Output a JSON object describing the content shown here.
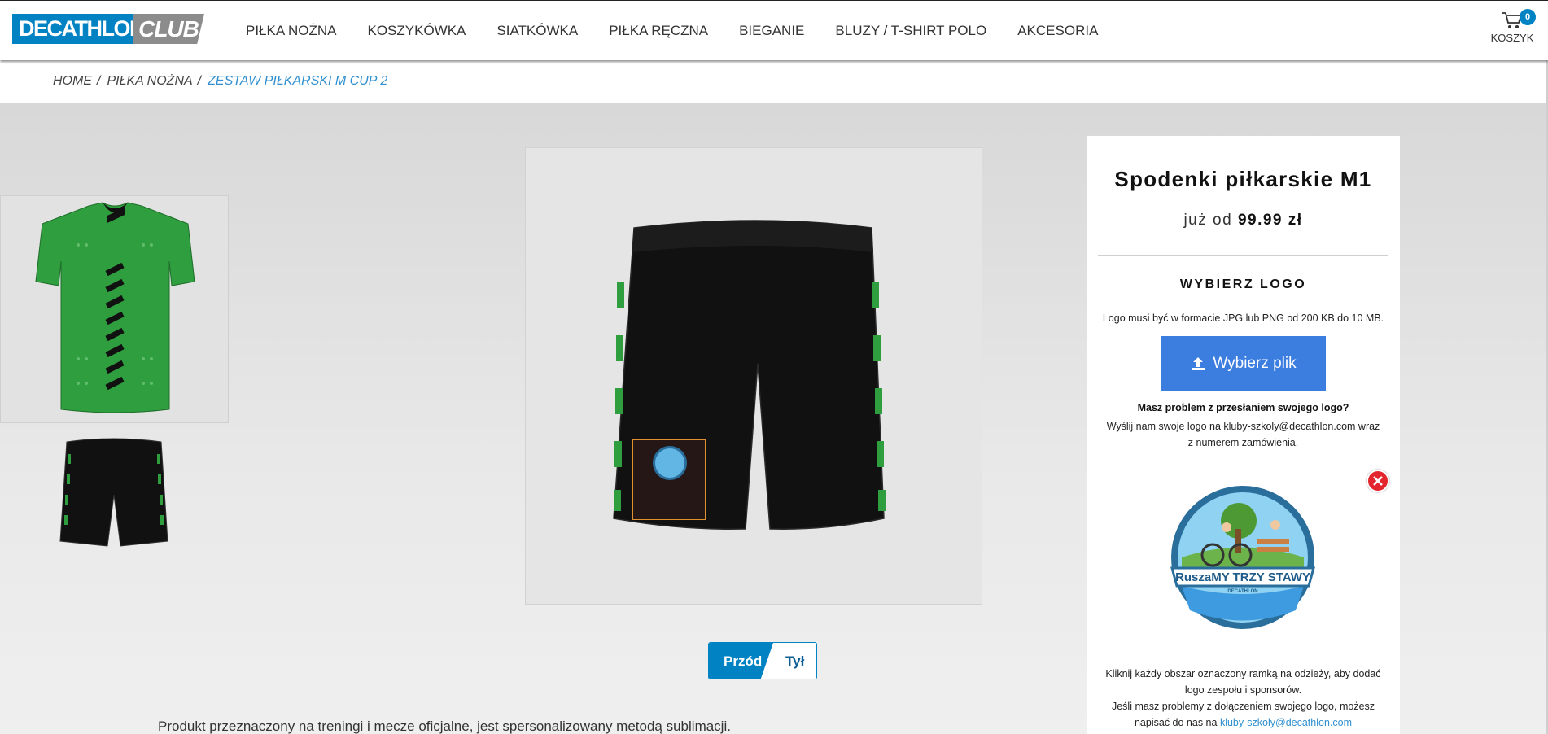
{
  "header": {
    "logo_main": "DECATHLON",
    "logo_sub": "CLUB",
    "nav": [
      {
        "label": "PIŁKA NOŻNA"
      },
      {
        "label": "KOSZYKÓWKA"
      },
      {
        "label": "SIATKÓWKA"
      },
      {
        "label": "PIŁKA RĘCZNA"
      },
      {
        "label": "BIEGANIE"
      },
      {
        "label": "BLUZY / T-SHIRT POLO"
      },
      {
        "label": "AKCESORIA"
      }
    ],
    "cart": {
      "count": "0",
      "label": "KOSZYK",
      "icon": "cart-icon"
    }
  },
  "breadcrumb": [
    {
      "label": "HOME"
    },
    {
      "label": "PIŁKA NOŻNA"
    },
    {
      "label": "ZESTAW PIŁKARSKI M CUP 2"
    }
  ],
  "view_toggle": {
    "front": "Przód",
    "back": "Tył",
    "selected": "Przód"
  },
  "description": "Produkt przeznaczony na treningi i mecze oficjalne, jest spersonalizowany metodą sublimacji.",
  "panel": {
    "product_name": "Spodenki piłkarskie M1",
    "price_prefix": "już od",
    "price": "99.99 zł",
    "choose_logo_title": "WYBIERZ LOGO",
    "logo_format_note": "Logo musi być w formacie JPG lub PNG od 200 KB do 10 MB.",
    "upload_button": "Wybierz plik",
    "problem_question": "Masz problem z przesłaniem swojego logo?",
    "problem_text": "Wyślij nam swoje logo na kluby-szkoly@decathlon.com wraz z numerem zamówienia.",
    "uploaded_logo_text": "RuszaMY TRZY STAWY",
    "uploaded_logo_subtext": "DECATHLON",
    "instructions_1": "Kliknij każdy obszar oznaczony ramką na odzieży, aby dodać logo zespołu i sponsorów.",
    "instructions_2": "Jeśli masz problemy z dołączeniem swojego logo, możesz napisać do nas na",
    "contact_email": "kluby-szkoly@decathlon.com"
  },
  "colors": {
    "brand_blue": "#0082c3",
    "upload_blue": "#3c7de0",
    "jersey_green": "#2f9e3e",
    "remove_red": "#e3262e",
    "logo_area_border": "#e0902f"
  }
}
